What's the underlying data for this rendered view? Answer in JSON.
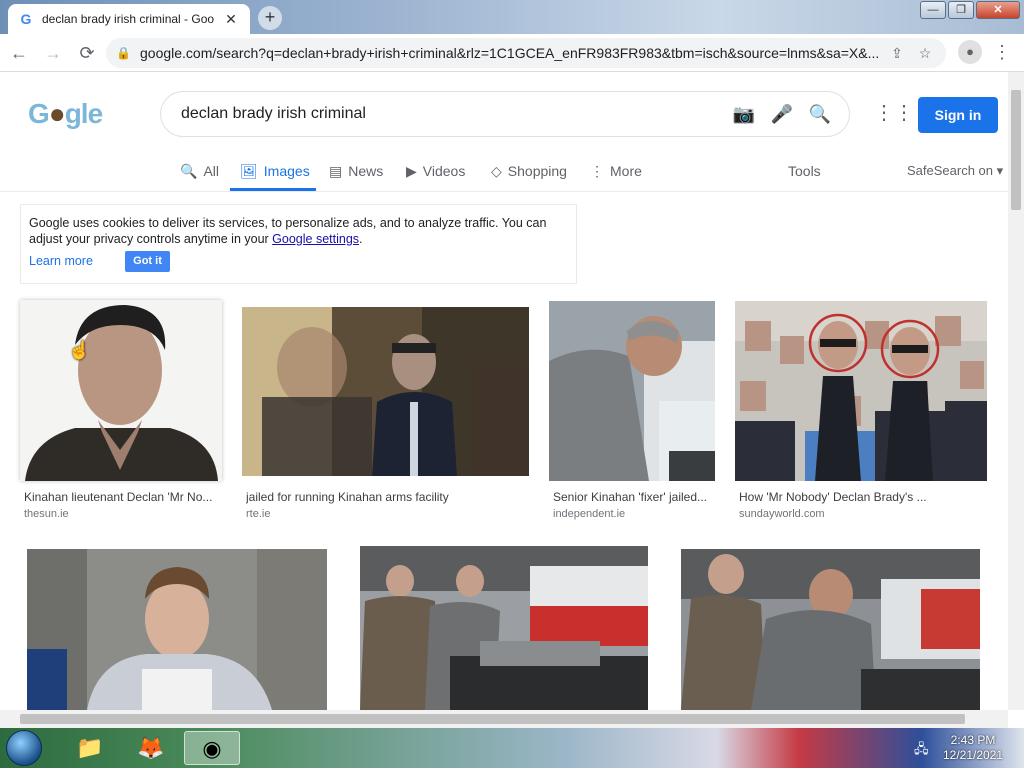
{
  "tab": {
    "title": "declan brady irish criminal - Goo",
    "favicon": "G",
    "close": "✕"
  },
  "newtab": "+",
  "window": {
    "min": "—",
    "max": "❐",
    "close": "✕"
  },
  "toolbar": {
    "url": "google.com/search?q=declan+brady+irish+criminal&rlz=1C1GCEA_enFR983FR983&tbm=isch&source=lnms&sa=X&...",
    "back": "←",
    "forward": "→",
    "reload": "⟳"
  },
  "logo": {
    "text_g": "G",
    "nut": "●",
    "text_rest": "gle"
  },
  "search": {
    "query": "declan brady irish criminal"
  },
  "signin": "Sign in",
  "navtabs": [
    {
      "label": "All",
      "icon": "🔍"
    },
    {
      "label": "Images",
      "icon": "🖼"
    },
    {
      "label": "News",
      "icon": "▤"
    },
    {
      "label": "Videos",
      "icon": "▶"
    },
    {
      "label": "Shopping",
      "icon": "◇"
    },
    {
      "label": "More",
      "icon": "⋮"
    }
  ],
  "tools": "Tools",
  "safesearch": "SafeSearch on ▾",
  "cookie": {
    "text": "Google uses cookies to deliver its services, to personalize ads, and to analyze traffic. You can adjust your privacy controls anytime in your",
    "link": "Google settings",
    "period": ".",
    "learn_more": "Learn more",
    "got_it": "Got it"
  },
  "results": [
    {
      "caption": "Kinahan lieutenant Declan 'Mr No...",
      "source": "thesun.ie"
    },
    {
      "caption": "jailed for running Kinahan arms facility",
      "source": "rte.ie"
    },
    {
      "caption": "Senior Kinahan 'fixer' jailed...",
      "source": "independent.ie"
    },
    {
      "caption": "How 'Mr Nobody' Declan Brady's ...",
      "source": "sundayworld.com"
    }
  ],
  "taskbar": {
    "time": "2:43 PM",
    "date": "12/21/2021"
  }
}
